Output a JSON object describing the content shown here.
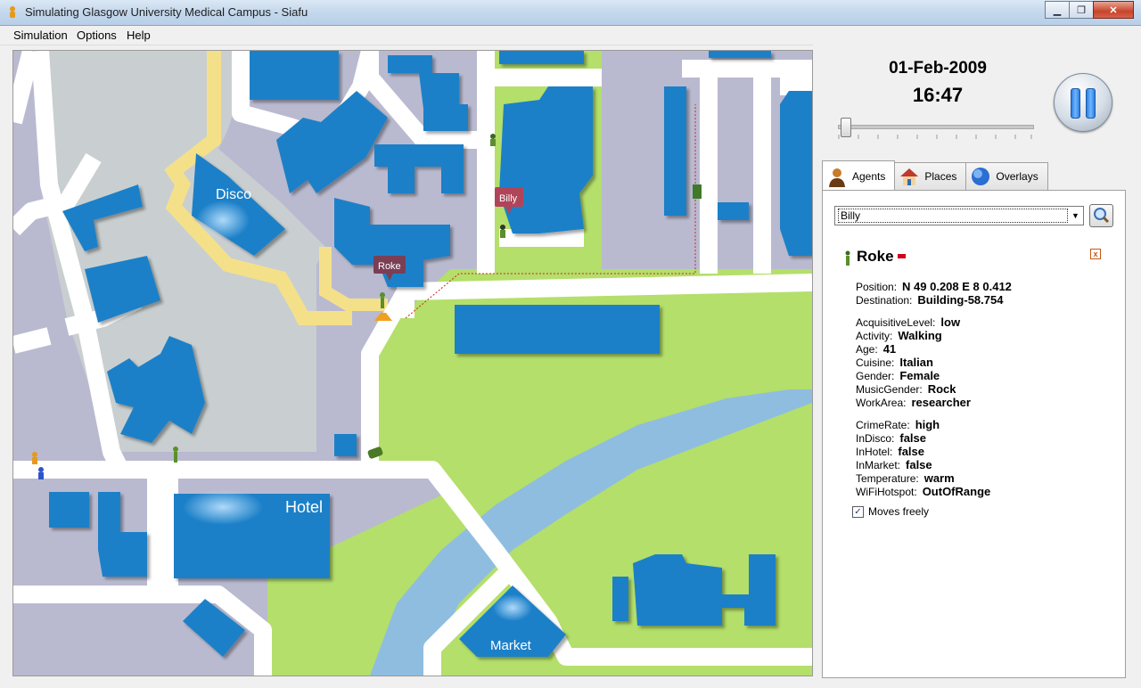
{
  "window": {
    "title": "Simulating Glasgow University Medical Campus - Siafu",
    "min": "▁",
    "max": "❐",
    "close": "✕"
  },
  "menu": {
    "items": [
      "Simulation",
      "Options",
      "Help"
    ]
  },
  "map": {
    "places": {
      "disco": "Disco",
      "hotel": "Hotel",
      "market": "Market"
    },
    "agent_tags": {
      "billy": "Billy",
      "roke": "Roke"
    }
  },
  "clock": {
    "date": "01-Feb-2009",
    "time": "16:47"
  },
  "sim_speed_fraction": 0.02,
  "tabs": [
    {
      "label": "Agents",
      "icon": "person-icon",
      "active": true
    },
    {
      "label": "Places",
      "icon": "house-icon",
      "active": false
    },
    {
      "label": "Overlays",
      "icon": "globe-icon",
      "active": false
    }
  ],
  "agent_select": {
    "value": "Billy"
  },
  "agent": {
    "name": "Roke",
    "props_a": [
      {
        "k": "Position:",
        "v": "N 49 0.208 E 8 0.412"
      },
      {
        "k": "Destination:",
        "v": "Building-58.754"
      }
    ],
    "props_b": [
      {
        "k": "AcquisitiveLevel:",
        "v": "low"
      },
      {
        "k": "Activity:",
        "v": "Walking"
      },
      {
        "k": "Age:",
        "v": "41"
      },
      {
        "k": "Cuisine:",
        "v": "Italian"
      },
      {
        "k": "Gender:",
        "v": "Female"
      },
      {
        "k": "MusicGender:",
        "v": "Rock"
      },
      {
        "k": "WorkArea:",
        "v": "researcher"
      }
    ],
    "props_c": [
      {
        "k": "CrimeRate:",
        "v": "high"
      },
      {
        "k": "InDisco:",
        "v": "false"
      },
      {
        "k": "InHotel:",
        "v": "false"
      },
      {
        "k": "InMarket:",
        "v": "false"
      },
      {
        "k": "Temperature:",
        "v": "warm"
      },
      {
        "k": "WiFiHotspot:",
        "v": "OutOfRange"
      }
    ],
    "moves_freely_label": "Moves freely",
    "moves_freely": true
  },
  "colors": {
    "building": "#1b80c8",
    "road": "#ffffff",
    "grass": "#b4df6a",
    "water": "#8fbde0",
    "ground": "#b9bad0",
    "path": "#f5e08a"
  }
}
